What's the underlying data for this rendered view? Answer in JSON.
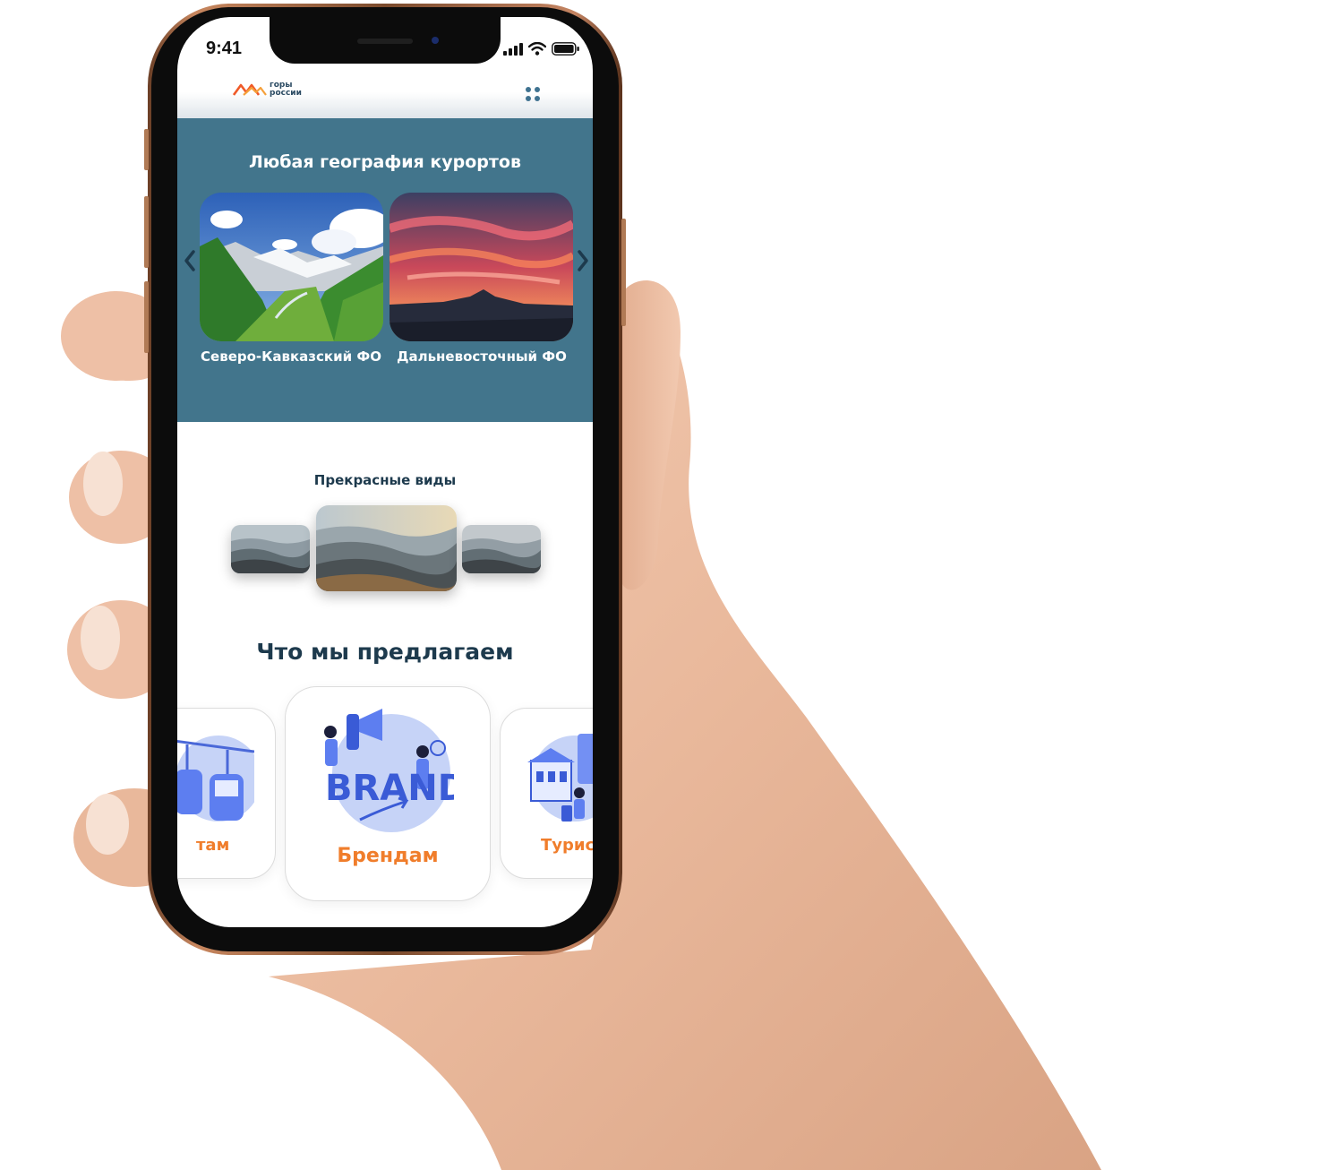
{
  "status_bar": {
    "time": "9:41"
  },
  "header": {
    "logo_line1": "горы",
    "logo_line2": "россии"
  },
  "geography": {
    "title": "Любая география курортов",
    "cards": [
      {
        "label": "Северо-Кавказский ФО"
      },
      {
        "label": "Дальневосточный ФО"
      }
    ]
  },
  "views": {
    "title": "Прекрасные виды"
  },
  "offers": {
    "title": "Что мы предлагаем",
    "items": [
      {
        "label": "там"
      },
      {
        "label": "Брендам",
        "illustration_text": "BRAND"
      },
      {
        "label": "Турис"
      }
    ]
  },
  "colors": {
    "section_bg": "#42758c",
    "accent_orange": "#f07d2b",
    "heading_dark": "#1d3a4d"
  }
}
